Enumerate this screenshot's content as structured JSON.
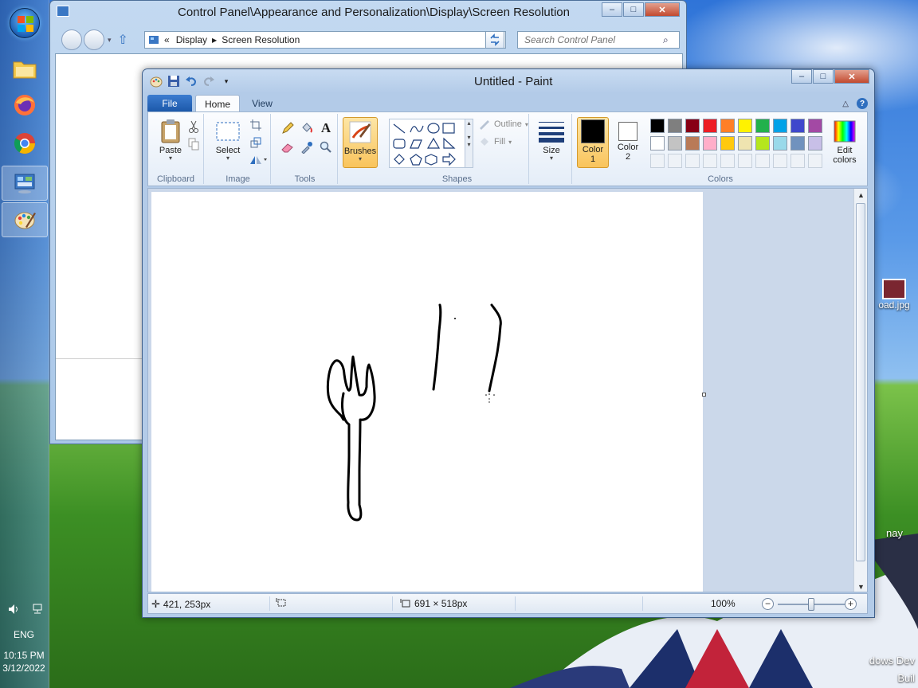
{
  "taskbar": {
    "language": "ENG",
    "time": "10:15 PM",
    "date": "3/12/2022"
  },
  "desktop": {
    "icon_label": "oad.jpg",
    "watermark_line1": "dows Dev",
    "watermark_line2": "Buil",
    "side_note": "nay"
  },
  "control_panel": {
    "title": "Control Panel\\Appearance and Personalization\\Display\\Screen Resolution",
    "breadcrumb": [
      "Display",
      "Screen Resolution"
    ],
    "breadcrumb_prefix": "«",
    "search_placeholder": "Search Control Panel"
  },
  "paint": {
    "title": "Untitled - Paint",
    "tabs": {
      "file": "File",
      "home": "Home",
      "view": "View"
    },
    "groups": {
      "clipboard": "Clipboard",
      "image": "Image",
      "tools": "Tools",
      "shapes": "Shapes",
      "colors": "Colors"
    },
    "buttons": {
      "paste": "Paste",
      "select": "Select",
      "brushes": "Brushes",
      "size": "Size",
      "outline": "Outline",
      "fill": "Fill",
      "color1_line1": "Color",
      "color1_line2": "1",
      "color2_line1": "Color",
      "color2_line2": "2",
      "edit_colors_line1": "Edit",
      "edit_colors_line2": "colors"
    },
    "color1": "#000000",
    "color2": "#ffffff",
    "palette_row1": [
      "#000000",
      "#7f7f7f",
      "#880015",
      "#ed1c24",
      "#ff7f27",
      "#fff200",
      "#22b14c",
      "#00a2e8",
      "#3f48cc",
      "#a349a4"
    ],
    "palette_row2": [
      "#ffffff",
      "#c3c3c3",
      "#b97a57",
      "#ffaec9",
      "#ffc90e",
      "#efe4b0",
      "#b5e61d",
      "#99d9ea",
      "#7092be",
      "#c8bfe7"
    ],
    "status": {
      "cursor_pos": "421, 253px",
      "canvas_size": "691 × 518px",
      "zoom": "100%"
    }
  }
}
